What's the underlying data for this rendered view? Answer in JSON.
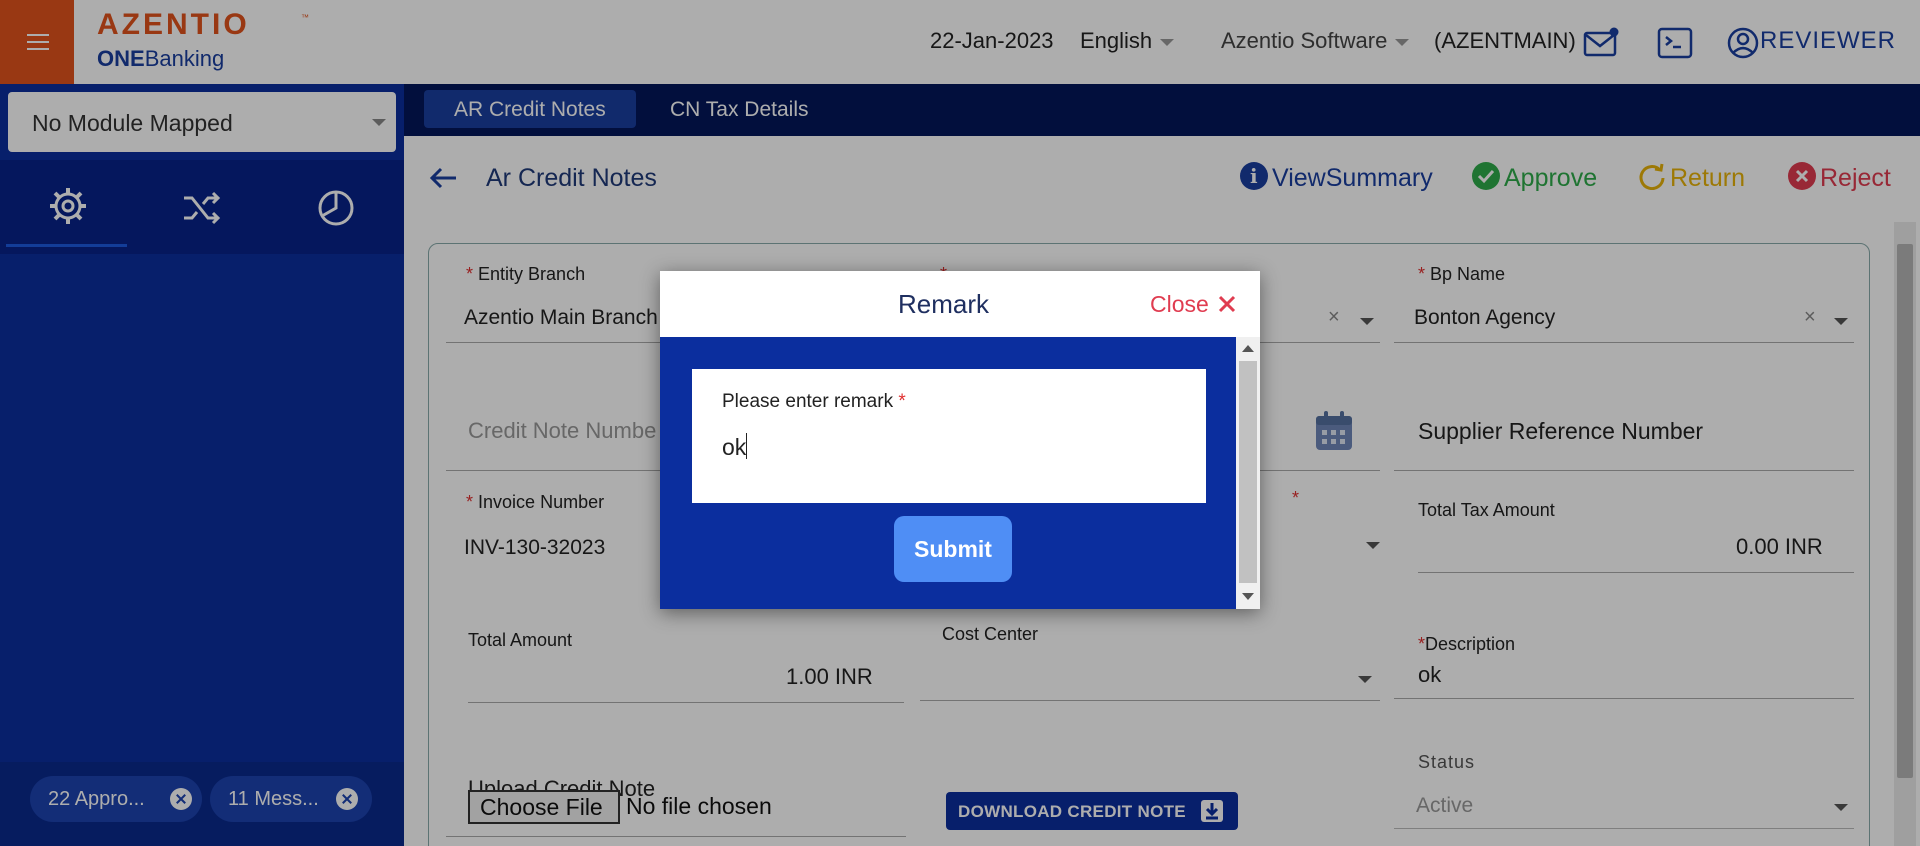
{
  "header": {
    "logo_main": "AZENTIO",
    "logo_tm": "™",
    "logo_sub_bold": "ONE",
    "logo_sub_rest": "Banking",
    "date": "22-Jan-2023",
    "language": "English",
    "company": "Azentio Software",
    "branch_code": "(AZENTMAIN)",
    "user": "REVIEWER"
  },
  "sidebar": {
    "module_select": "No Module Mapped",
    "tabs": [
      "settings-icon",
      "shuffle-icon",
      "chart-pie-icon"
    ],
    "chips": [
      {
        "label": "22 Appro..."
      },
      {
        "label": "11 Mess..."
      }
    ]
  },
  "tabs": [
    {
      "label": "AR Credit Notes",
      "active": true
    },
    {
      "label": "CN Tax Details",
      "active": false
    }
  ],
  "page": {
    "title": "Ar Credit Notes",
    "actions": {
      "view_summary": "ViewSummary",
      "approve": "Approve",
      "return": "Return",
      "reject": "Reject"
    }
  },
  "form": {
    "entity_branch_label": "Entity Branch",
    "entity_branch_value": "Azentio Main Branch",
    "bp_name_label": "Bp Name",
    "bp_name_value": "Bonton Agency",
    "credit_note_number_placeholder": "Credit Note Numbe",
    "supplier_ref_placeholder": "Supplier Reference Number",
    "invoice_number_label": "Invoice Number",
    "invoice_number_value": "INV-130-32023",
    "total_tax_label": "Total Tax Amount",
    "total_tax_value": "0.00 INR",
    "total_amount_label": "Total Amount",
    "total_amount_value": "1.00 INR",
    "cost_center_label": "Cost Center",
    "description_label": "Description",
    "description_value": "ok",
    "upload_label": "Upload Credit Note",
    "choose_file": "Choose File",
    "no_file": "No file chosen",
    "download_label": "DOWNLOAD CREDIT NOTE",
    "status_label": "Status",
    "status_value": "Active",
    "required_mark": "*",
    "clear_glyph": "×"
  },
  "modal": {
    "title": "Remark",
    "close_label": "Close",
    "remark_label": "Please enter remark",
    "remark_value": "ok",
    "submit_label": "Submit"
  },
  "colors": {
    "brand_orange": "#e2531c",
    "nav_blue": "#0b2e9e",
    "tab_dark": "#03175a",
    "approve_green": "#2eac4a",
    "return_yellow": "#e8b30a",
    "reject_red": "#e03c50"
  }
}
